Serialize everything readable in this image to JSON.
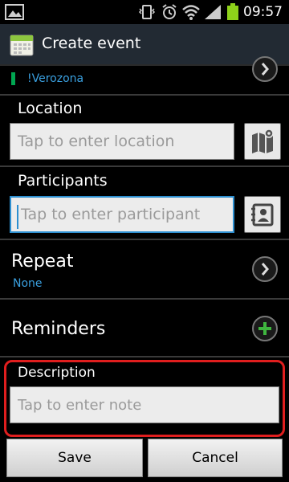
{
  "status_bar": {
    "time": "09:57"
  },
  "action_bar": {
    "title": "Create event"
  },
  "calendar": {
    "name": "!Verozona",
    "color": "#00a651"
  },
  "location": {
    "label": "Location",
    "placeholder": "Tap to enter location"
  },
  "participants": {
    "label": "Participants",
    "placeholder": "Tap to enter participant"
  },
  "repeat": {
    "label": "Repeat",
    "value": "None"
  },
  "reminders": {
    "label": "Reminders"
  },
  "description": {
    "label": "Description",
    "placeholder": "Tap to enter note"
  },
  "footer": {
    "save_label": "Save",
    "cancel_label": "Cancel"
  },
  "colors": {
    "accent_blue": "#2d8fd0",
    "highlight_red": "#e01e1e",
    "add_green": "#3fb63f"
  }
}
